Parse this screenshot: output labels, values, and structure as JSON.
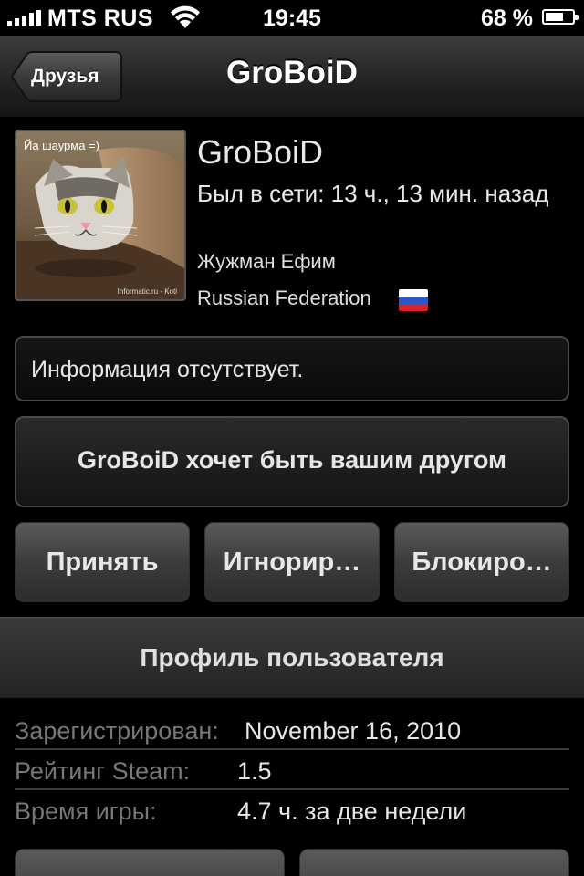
{
  "status_bar": {
    "carrier": "MTS RUS",
    "time": "19:45",
    "battery": "68 %",
    "battery_level": 0.68
  },
  "nav": {
    "back_label": "Друзья",
    "title": "GroBoiD"
  },
  "profile": {
    "avatar_caption": "Йа шаурма =)",
    "avatar_credit": "Informatic.ru - Koti",
    "name": "GroBoiD",
    "last_online": "Был в сети: 13 ч., 13 мин. назад",
    "real_name": "Жужман Ефим",
    "country": "Russian Federation"
  },
  "info_text": "Информация отсутствует.",
  "friend_request_text": "GroBoiD хочет быть вашим другом",
  "actions": {
    "accept": "Принять",
    "ignore": "Игнорир…",
    "block": "Блокиро…"
  },
  "section_title": "Профиль пользователя",
  "stats": [
    {
      "label": "Зарегистрирован:",
      "value": "November 16, 2010"
    },
    {
      "label": "Рейтинг Steam:",
      "value": "1.5"
    },
    {
      "label": "Время игры:",
      "value": "4.7 ч. за две недели"
    }
  ]
}
